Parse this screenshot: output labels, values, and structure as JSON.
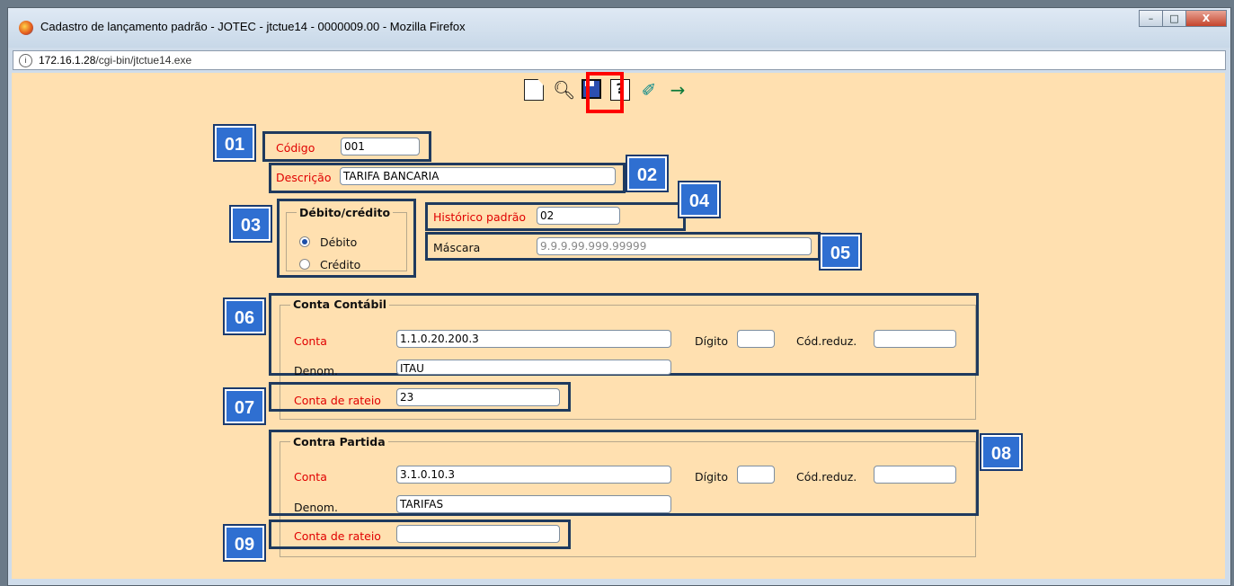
{
  "window": {
    "title": "Cadastro de lançamento padrão - JOTEC - jtctue14 - 0000009.00 - Mozilla Firefox",
    "url_host": "172.16.1.28",
    "url_path": "/cgi-bin/jtctue14.exe",
    "controls": {
      "minimize": "–",
      "maximize": "□",
      "close": "X"
    }
  },
  "toolbar": {
    "icons": [
      "new-icon",
      "find-icon",
      "save-icon",
      "help-icon",
      "book-icon",
      "exit-icon"
    ],
    "highlighted": "save-icon",
    "highlight_color": "#ff0000"
  },
  "form": {
    "codigo": {
      "label": "Código",
      "value": "001"
    },
    "descricao": {
      "label": "Descrição",
      "value": "TARIFA BANCARIA"
    },
    "debito_credito": {
      "legend": "Débito/crédito",
      "options": [
        "Débito",
        "Crédito"
      ],
      "selected": "Débito"
    },
    "historico_padrao": {
      "label": "Histórico padrão",
      "value": "02"
    },
    "mascara": {
      "label": "Máscara",
      "value": "9.9.9.99.999.99999"
    },
    "conta_contabil": {
      "legend": "Conta Contábil",
      "conta_label": "Conta",
      "conta_value": "1.1.0.20.200.3",
      "digito_label": "Dígito",
      "digito_value": "",
      "cod_reduz_label": "Cód.reduz.",
      "cod_reduz_value": "",
      "denom_label": "Denom.",
      "denom_value": "ITAU",
      "rateio_label": "Conta de rateio",
      "rateio_value": "23"
    },
    "contra_partida": {
      "legend": "Contra Partida",
      "conta_label": "Conta",
      "conta_value": "3.1.0.10.3",
      "digito_label": "Dígito",
      "digito_value": "",
      "cod_reduz_label": "Cód.reduz.",
      "cod_reduz_value": "",
      "denom_label": "Denom.",
      "denom_value": "TARIFAS",
      "rateio_label": "Conta de rateio",
      "rateio_value": ""
    }
  },
  "badges": [
    "01",
    "02",
    "03",
    "04",
    "05",
    "06",
    "07",
    "08",
    "09"
  ],
  "colors": {
    "background": "#ffe0b0",
    "badge": "#2f6fd1",
    "required_label": "#e00000"
  }
}
